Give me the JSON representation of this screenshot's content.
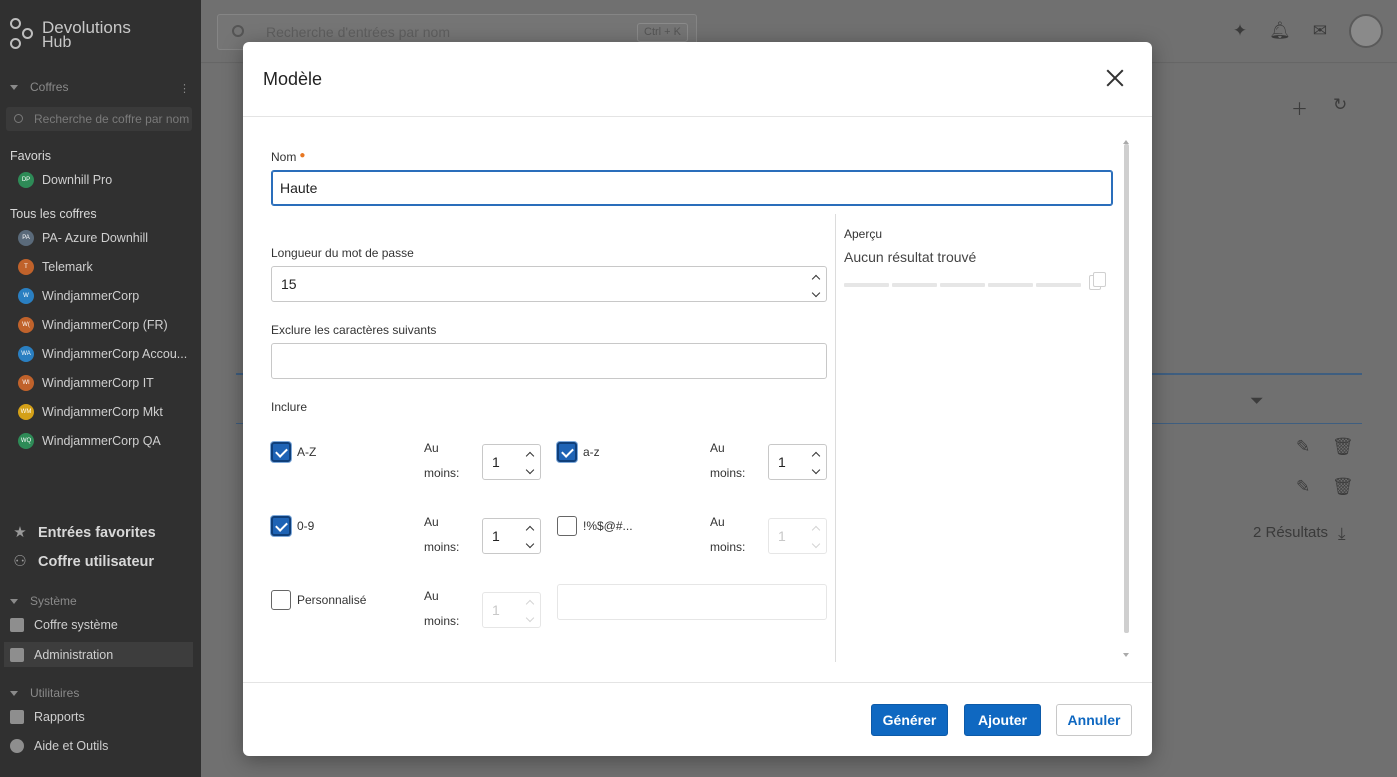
{
  "app": {
    "logo_line1": "Devolutions",
    "logo_line2": "Hub"
  },
  "sidebar": {
    "vaults_section": "Coffres",
    "vault_search_placeholder": "Recherche de coffre par nom",
    "favorites_heading": "Favoris",
    "favorites": [
      {
        "label": "Downhill Pro",
        "initials": "DP",
        "color": "#2e8b57"
      }
    ],
    "all_vaults_heading": "Tous les coffres",
    "vaults": [
      {
        "label": "PA- Azure Downhill",
        "initials": "PA",
        "color": "#5a6a7a"
      },
      {
        "label": "Telemark",
        "initials": "T",
        "color": "#c0622b"
      },
      {
        "label": "WindjammerCorp",
        "initials": "W",
        "color": "#2a7fc1"
      },
      {
        "label": "WindjammerCorp (FR)",
        "initials": "W(",
        "color": "#c0622b"
      },
      {
        "label": "WindjammerCorp Accou...",
        "initials": "WA",
        "color": "#2a7fc1"
      },
      {
        "label": "WindjammerCorp IT",
        "initials": "WI",
        "color": "#c0622b"
      },
      {
        "label": "WindjammerCorp Mkt",
        "initials": "WM",
        "color": "#d4a017"
      },
      {
        "label": "WindjammerCorp QA",
        "initials": "WQ",
        "color": "#2e8b57"
      }
    ],
    "favorite_entries": "Entrées favorites",
    "user_vault": "Coffre utilisateur",
    "system_section": "Système",
    "system_vault": "Coffre système",
    "administration": "Administration",
    "utilities_section": "Utilitaires",
    "reports": "Rapports",
    "help_tools": "Aide et Outils"
  },
  "topbar": {
    "search_placeholder": "Recherche d'entrées par nom",
    "shortcut": "Ctrl + K"
  },
  "background": {
    "results": "2 Résultats"
  },
  "modal": {
    "title": "Modèle",
    "name_label": "Nom",
    "name_value": "Haute",
    "length_label": "Longueur du mot de passe",
    "length_value": "15",
    "exclude_label": "Exclure les caractères suivants",
    "exclude_value": "",
    "include_label": "Inclure",
    "at_least_l1": "Au",
    "at_least_l2": "moins:",
    "options": {
      "upper": {
        "label": "A-Z",
        "checked": true,
        "min": "1"
      },
      "lower": {
        "label": "a-z",
        "checked": true,
        "min": "1"
      },
      "digits": {
        "label": "0-9",
        "checked": true,
        "min": "1"
      },
      "symbols": {
        "label": "!%$@#...",
        "checked": false,
        "min": "1"
      },
      "custom": {
        "label": "Personnalisé",
        "checked": false,
        "min": "1",
        "value": ""
      }
    },
    "preview_label": "Aperçu",
    "preview_value": "Aucun résultat trouvé",
    "generate_button": "Générer",
    "add_button": "Ajouter",
    "cancel_button": "Annuler"
  }
}
